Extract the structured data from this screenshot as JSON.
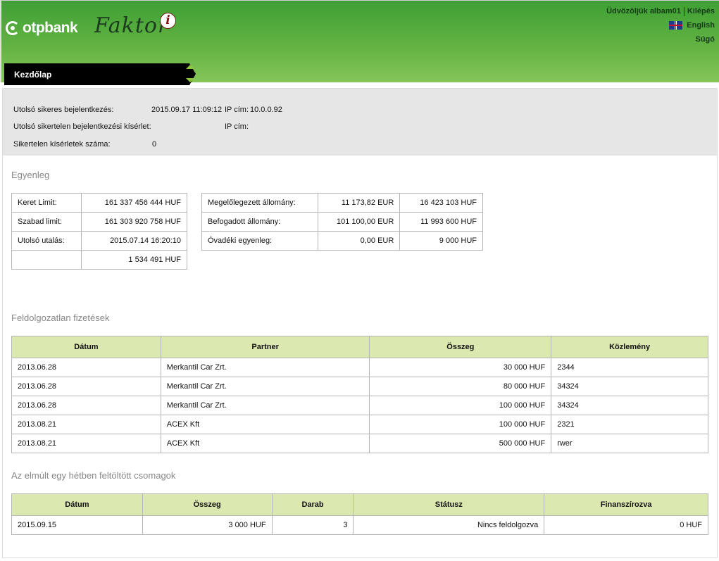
{
  "header": {
    "logo_text": "otpbank",
    "app_name": "Faktor",
    "app_badge": "i",
    "welcome": "Üdvözöljük albam01",
    "logout": "Kilépés",
    "language": "English",
    "help": "Súgó"
  },
  "nav": {
    "tab_label": "Kezdőlap"
  },
  "login": {
    "last_success_label": "Utolsó sikeres bejelentkezés:",
    "last_success_value": "2015.09.17 11:09:12",
    "ip_label_1": "IP cím:",
    "ip_value_1": "10.0.0.92",
    "last_fail_label": "Utolsó sikertelen bejelentkezési kísérlet:",
    "ip_label_2": "IP cím:",
    "fail_count_label": "Sikertelen kísérletek száma:",
    "fail_count_value": "0"
  },
  "balance": {
    "title": "Egyenleg",
    "left": [
      {
        "label": "Keret Limit:",
        "value": "161 337 456 444  HUF"
      },
      {
        "label": "Szabad limit:",
        "value": "161 303 920 758  HUF"
      },
      {
        "label": "Utolsó utalás:",
        "value": "2015.07.14 16:20:10"
      },
      {
        "label": "",
        "value": "1 534 491  HUF"
      }
    ],
    "right": [
      {
        "label": "Megelőlegezett állomány:",
        "eur": "11 173,82  EUR",
        "huf": "16 423 103  HUF"
      },
      {
        "label": "Befogadott állomány:",
        "eur": "101 100,00  EUR",
        "huf": "11 993 600  HUF"
      },
      {
        "label": "Óvadéki egyenleg:",
        "eur": "0,00  EUR",
        "huf": "9 000  HUF"
      }
    ]
  },
  "unprocessed": {
    "title": "Feldolgozatlan fizetések",
    "columns": [
      "Dátum",
      "Partner",
      "Összeg",
      "Közlemény"
    ],
    "rows": [
      [
        "2013.06.28",
        "Merkantil Car Zrt.",
        "30 000  HUF",
        "2344"
      ],
      [
        "2013.06.28",
        "Merkantil Car Zrt.",
        "80 000  HUF",
        "34324"
      ],
      [
        "2013.06.28",
        "Merkantil Car Zrt.",
        "100 000  HUF",
        "34324"
      ],
      [
        "2013.08.21",
        "ACEX Kft",
        "100 000  HUF",
        "2321"
      ],
      [
        "2013.08.21",
        "ACEX Kft",
        "500 000  HUF",
        "rwer"
      ]
    ]
  },
  "packages": {
    "title": "Az elmúlt egy hétben feltöltött csomagok",
    "columns": [
      "Dátum",
      "Összeg",
      "Darab",
      "Státusz",
      "Finanszírozva"
    ],
    "rows": [
      [
        "2015.09.15",
        "3 000  HUF",
        "3",
        "Nincs feldolgozva",
        "0  HUF"
      ]
    ]
  }
}
